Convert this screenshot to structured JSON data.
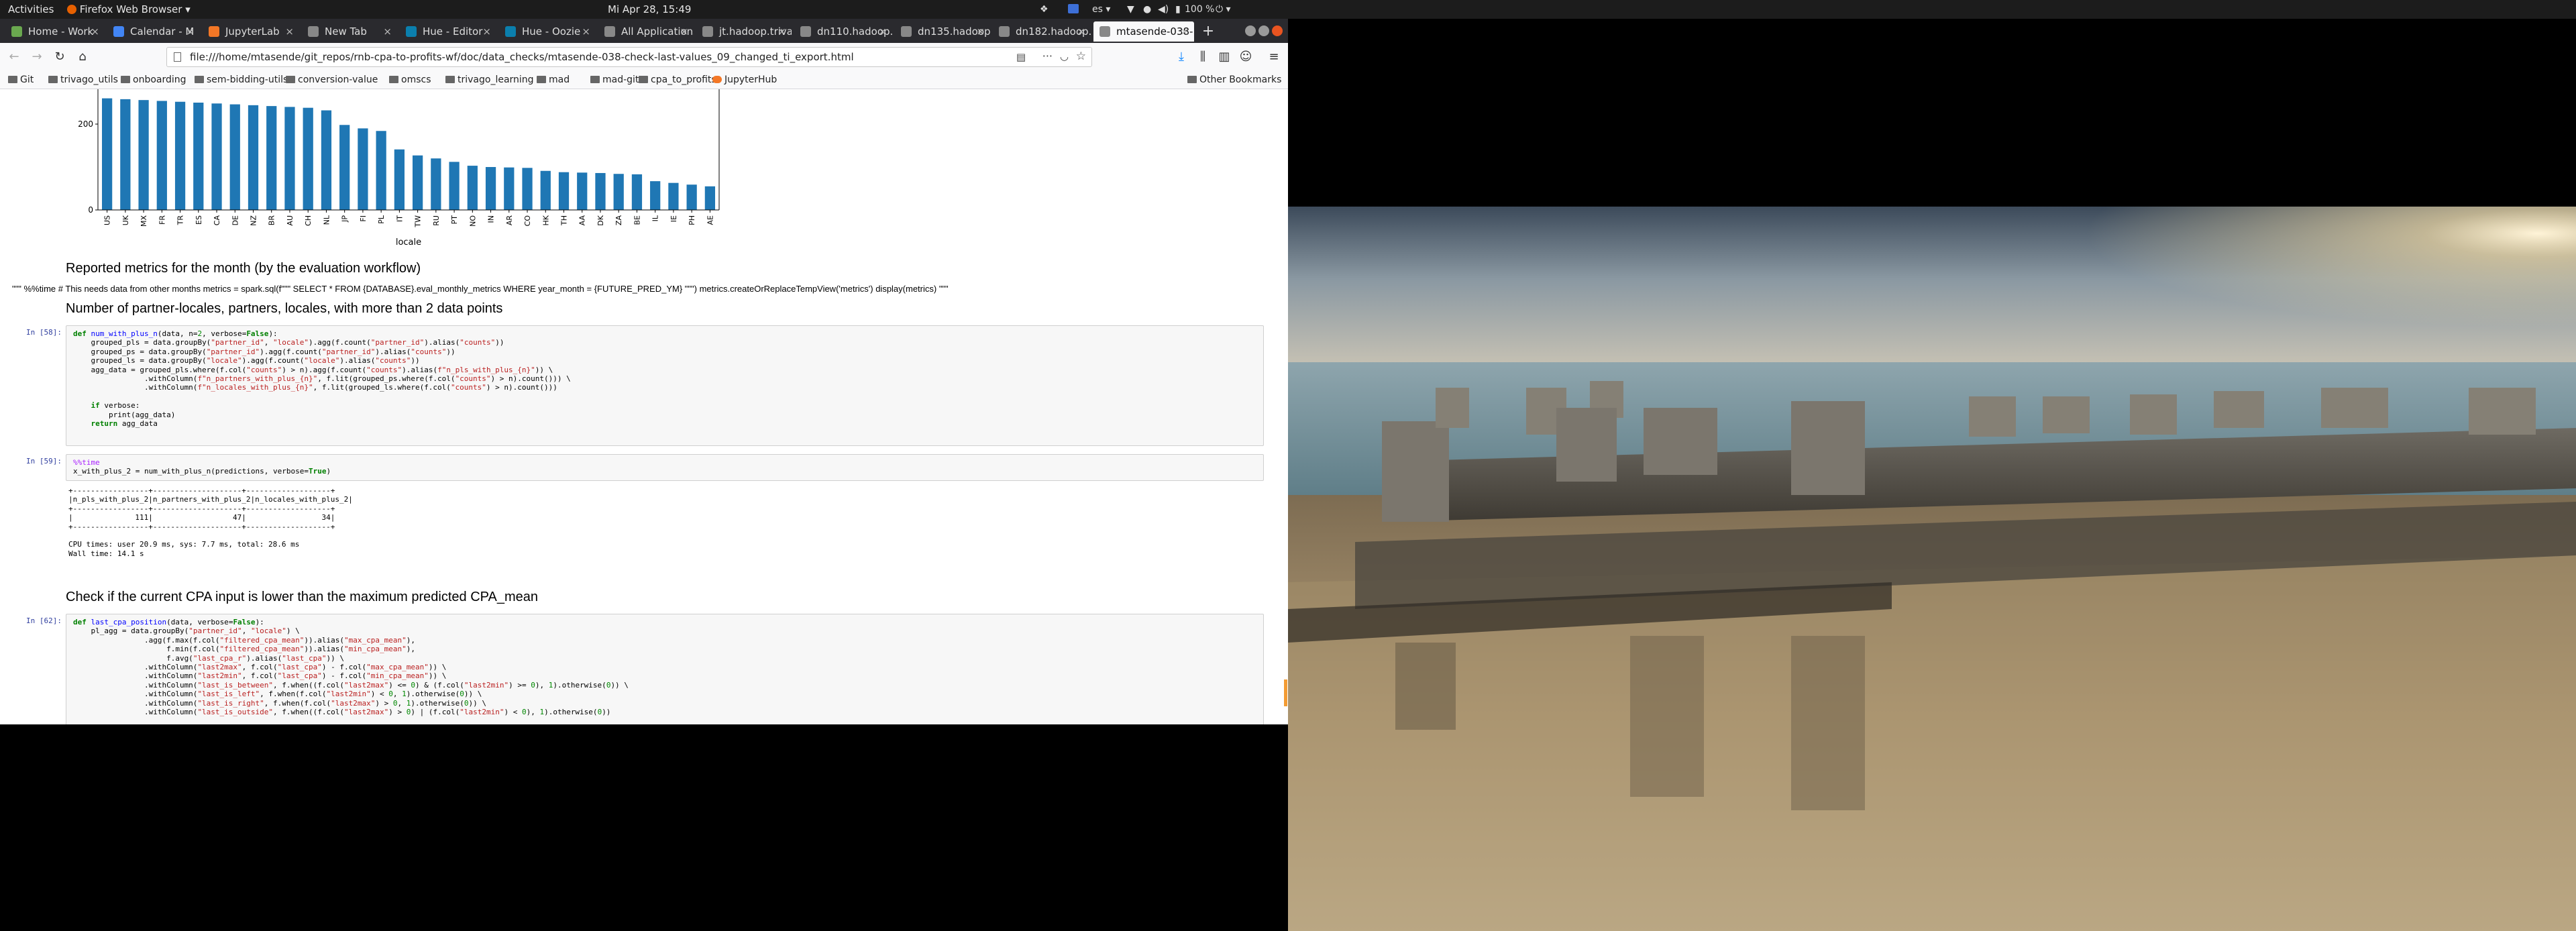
{
  "topbar": {
    "activities": "Activities",
    "app_menu": "Firefox Web Browser",
    "clock": "Mi Apr 28, 15:49",
    "keyboard_layout": "es",
    "battery": "100 %"
  },
  "tabs": [
    {
      "label": "Home - Work",
      "color": "#6aa84f"
    },
    {
      "label": "Calendar - M",
      "color": "#4285f4"
    },
    {
      "label": "JupyterLab",
      "color": "#f37726"
    },
    {
      "label": "New Tab",
      "color": "#888888"
    },
    {
      "label": "Hue - Editor",
      "color": "#0b7fad"
    },
    {
      "label": "Hue - Oozie",
      "color": "#0b7fad"
    },
    {
      "label": "All Applications",
      "color": "#888888"
    },
    {
      "label": "jt.hadoop.triva",
      "color": "#888888"
    },
    {
      "label": "dn110.hadoop.",
      "color": "#888888"
    },
    {
      "label": "dn135.hadoop.",
      "color": "#888888"
    },
    {
      "label": "dn182.hadoop.",
      "color": "#888888"
    },
    {
      "label": "mtasende-038-",
      "color": "#888888"
    }
  ],
  "nav": {
    "url": "file:///home/mtasende/git_repos/rnb-cpa-to-profits-wf/doc/data_checks/mtasende-038-check-last-values_09_changed_ti_export.html"
  },
  "bookmarks": [
    {
      "label": "Git"
    },
    {
      "label": "trivago_utils"
    },
    {
      "label": "onboarding"
    },
    {
      "label": "sem-bidding-utils"
    },
    {
      "label": "conversion-value"
    },
    {
      "label": "omscs"
    },
    {
      "label": "trivago_learning"
    },
    {
      "label": "mad"
    },
    {
      "label": "mad-git"
    },
    {
      "label": "cpa_to_profits"
    },
    {
      "label": "JupyterHub"
    }
  ],
  "other_bookmarks": "Other Bookmarks",
  "chart_data": {
    "type": "bar",
    "xlabel": "locale",
    "ylabel": "",
    "yticks": [
      0,
      200
    ],
    "ylim": [
      0,
      280
    ],
    "bar_color": "#1f77b4",
    "categories": [
      "US",
      "UK",
      "MX",
      "FR",
      "TR",
      "ES",
      "CA",
      "DE",
      "NZ",
      "BR",
      "AU",
      "CH",
      "NL",
      "JP",
      "FI",
      "PL",
      "IT",
      "TW",
      "RU",
      "PT",
      "NO",
      "IN",
      "AR",
      "CO",
      "HK",
      "TH",
      "AA",
      "DK",
      "ZA",
      "BE",
      "IL",
      "IE",
      "PH",
      "AE"
    ],
    "values": [
      260,
      258,
      256,
      254,
      252,
      250,
      248,
      246,
      244,
      242,
      240,
      238,
      232,
      198,
      190,
      184,
      141,
      127,
      120,
      112,
      103,
      100,
      99,
      98,
      91,
      88,
      87,
      86,
      84,
      83,
      67,
      63,
      59,
      55
    ]
  },
  "notebook": {
    "h_reported": "Reported metrics for the month (by the evaluation workflow)",
    "md_raw": "\"\"\" %%time # This needs data from other months metrics = spark.sql(f\"\"\" SELECT * FROM {DATABASE}.eval_monthly_metrics WHERE year_month = {FUTURE_PRED_YM} \"\"\") metrics.createOrReplaceTempView('metrics') display(metrics) \"\"\"",
    "h_number": "Number of partner-locales, partners, locales, with more than 2 data points",
    "prompt_58": "In [58]:",
    "prompt_59": "In [59]:",
    "prompt_62": "In [62]:",
    "out_59": "+-----------------+--------------------+-------------------+\n|n_pls_with_plus_2|n_partners_with_plus_2|n_locales_with_plus_2|\n+-----------------+--------------------+-------------------+\n|              111|                  47|                 34|\n+-----------------+--------------------+-------------------+\n\nCPU times: user 20.9 ms, sys: 7.7 ms, total: 28.6 ms\nWall time: 14.1 s",
    "h_check": "Check if the current CPA input is lower than the maximum predicted CPA_mean"
  }
}
